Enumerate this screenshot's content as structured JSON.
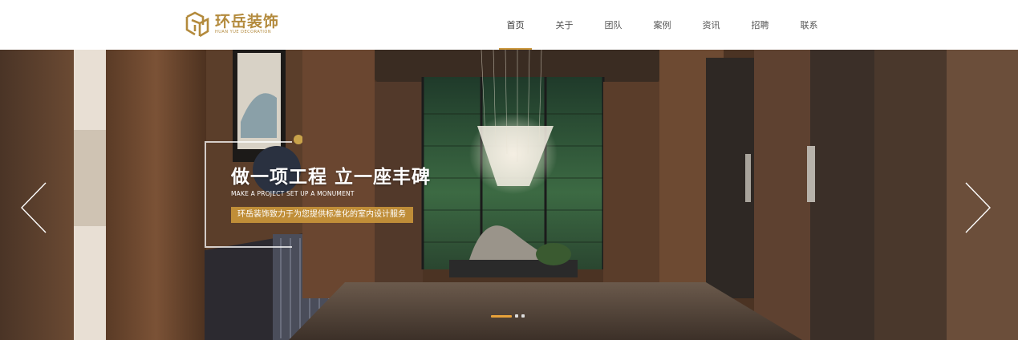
{
  "brand": {
    "name_cn": "环岳装饰",
    "name_en": "HUAN YUE DECORATION",
    "color": "#b38a3c"
  },
  "nav": {
    "items": [
      {
        "label": "首页",
        "active": true
      },
      {
        "label": "关于",
        "active": false
      },
      {
        "label": "团队",
        "active": false
      },
      {
        "label": "案例",
        "active": false
      },
      {
        "label": "资讯",
        "active": false
      },
      {
        "label": "招聘",
        "active": false
      },
      {
        "label": "联系",
        "active": false
      }
    ],
    "accent": "#c9953a"
  },
  "banner": {
    "headline": "做一项工程 立一座丰碑",
    "subline": "MAKE A PROJECT SET UP A MONUMENT",
    "tagline": "环岳装饰致力于为您提供标准化的室内设计服务",
    "tagline_color": "#c9953a",
    "prev_icon": "chevron-left-icon",
    "next_icon": "chevron-right-icon",
    "slides_total": 3,
    "slide_active": 1
  }
}
